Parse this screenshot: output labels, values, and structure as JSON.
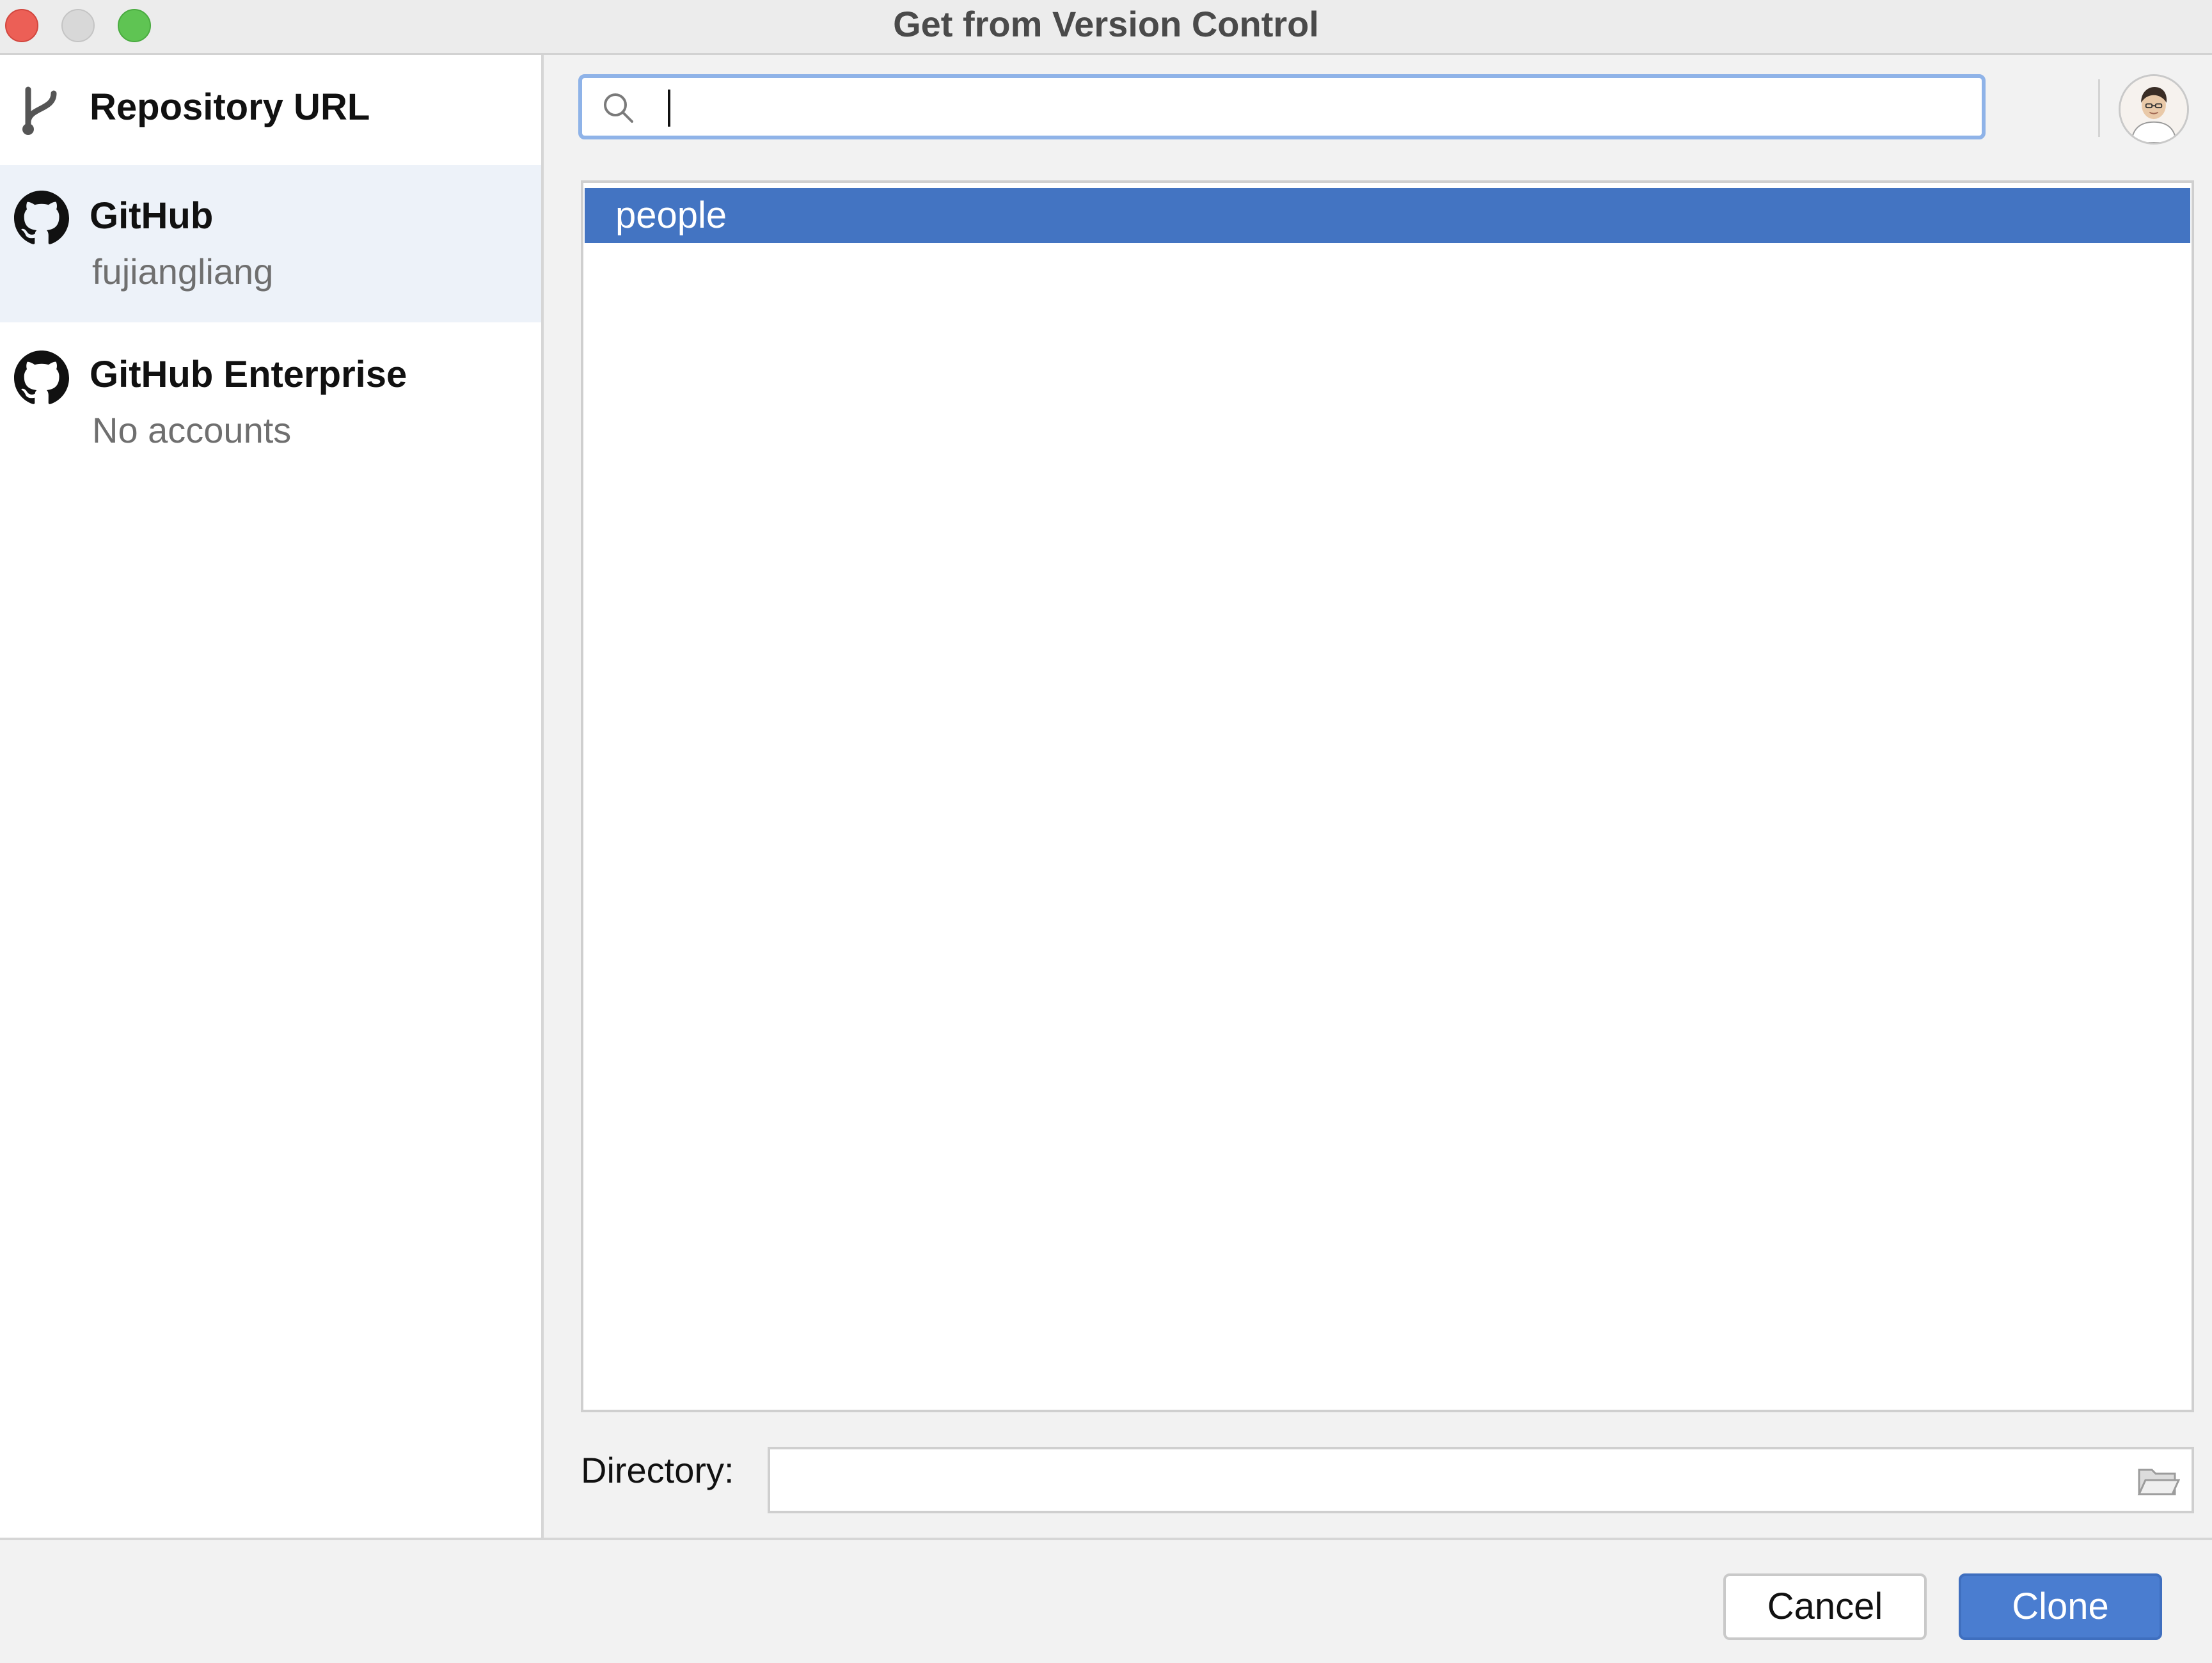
{
  "window": {
    "title": "Get from Version Control"
  },
  "sidebar": {
    "items": [
      {
        "title": "Repository URL",
        "subtitle": "",
        "icon": "git-branch-icon",
        "selected": false
      },
      {
        "title": "GitHub",
        "subtitle": "fujiangliang",
        "icon": "github-icon",
        "selected": true
      },
      {
        "title": "GitHub Enterprise",
        "subtitle": "No accounts",
        "icon": "github-icon",
        "selected": false
      }
    ]
  },
  "search": {
    "value": "",
    "placeholder": ""
  },
  "repositories": {
    "items": [
      {
        "name": "people",
        "selected": true
      }
    ]
  },
  "directory": {
    "label": "Directory:",
    "value": ""
  },
  "buttons": {
    "cancel": "Cancel",
    "clone": "Clone"
  },
  "colors": {
    "selection": "#4374c2",
    "primary_button": "#4a7dd0",
    "focus_ring": "#8fb3e8",
    "sidebar_selected": "#edf2f9"
  }
}
